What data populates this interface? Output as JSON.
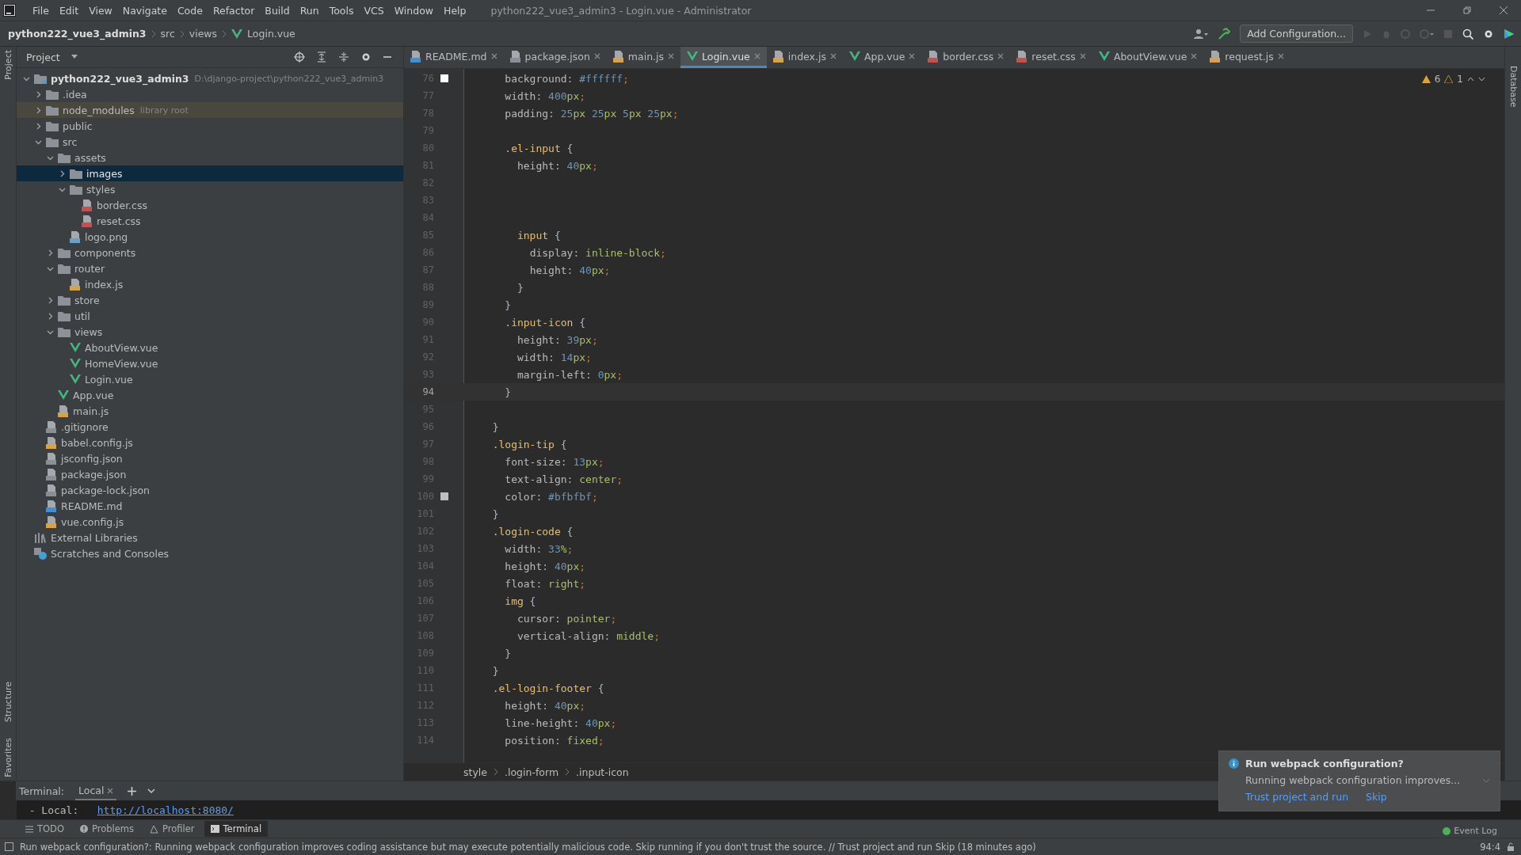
{
  "window": {
    "title": "python222_vue3_admin3 - Login.vue - Administrator",
    "menu": [
      "File",
      "Edit",
      "View",
      "Navigate",
      "Code",
      "Refactor",
      "Build",
      "Run",
      "Tools",
      "VCS",
      "Window",
      "Help"
    ]
  },
  "nav": {
    "crumbs": [
      {
        "label": "python222_vue3_admin3",
        "kind": "project"
      },
      {
        "label": "src",
        "kind": "folder"
      },
      {
        "label": "views",
        "kind": "folder"
      },
      {
        "label": "Login.vue",
        "kind": "vue"
      }
    ],
    "run_config": "Add Configuration..."
  },
  "side_strip": {
    "top": "Project",
    "bottom": [
      "Structure",
      "Favorites"
    ],
    "right": "Database"
  },
  "project": {
    "title": "Project",
    "tree": [
      {
        "name": "python222_vue3_admin3",
        "kind": "root",
        "hint": "D:\\django-project\\python222_vue3_admin3",
        "expanded": true,
        "selected": false,
        "children": [
          {
            "name": ".idea",
            "kind": "folder",
            "expanded": false,
            "selected": false
          },
          {
            "name": "node_modules",
            "kind": "folder",
            "hint": "library root",
            "library": true,
            "expanded": false,
            "selected": false
          },
          {
            "name": "public",
            "kind": "folder",
            "expanded": false,
            "selected": false
          },
          {
            "name": "src",
            "kind": "folder",
            "expanded": true,
            "selected": false,
            "children": [
              {
                "name": "assets",
                "kind": "folder",
                "expanded": true,
                "selected": false,
                "children": [
                  {
                    "name": "images",
                    "kind": "folder",
                    "expanded": false,
                    "selected": true
                  },
                  {
                    "name": "styles",
                    "kind": "folder",
                    "expanded": true,
                    "selected": false,
                    "children": [
                      {
                        "name": "border.css",
                        "kind": "css",
                        "selected": false
                      },
                      {
                        "name": "reset.css",
                        "kind": "css",
                        "selected": false
                      }
                    ]
                  },
                  {
                    "name": "logo.png",
                    "kind": "png",
                    "selected": false
                  }
                ]
              },
              {
                "name": "components",
                "kind": "folder",
                "expanded": false,
                "selected": false
              },
              {
                "name": "router",
                "kind": "folder",
                "expanded": true,
                "selected": false,
                "children": [
                  {
                    "name": "index.js",
                    "kind": "js",
                    "selected": false
                  }
                ]
              },
              {
                "name": "store",
                "kind": "folder",
                "expanded": false,
                "selected": false
              },
              {
                "name": "util",
                "kind": "folder",
                "expanded": false,
                "selected": false
              },
              {
                "name": "views",
                "kind": "folder",
                "expanded": true,
                "selected": false,
                "children": [
                  {
                    "name": "AboutView.vue",
                    "kind": "vue",
                    "selected": false
                  },
                  {
                    "name": "HomeView.vue",
                    "kind": "vue",
                    "selected": false
                  },
                  {
                    "name": "Login.vue",
                    "kind": "vue",
                    "selected": false
                  }
                ]
              },
              {
                "name": "App.vue",
                "kind": "vue",
                "selected": false
              },
              {
                "name": "main.js",
                "kind": "js",
                "selected": false
              }
            ]
          },
          {
            "name": ".gitignore",
            "kind": "file",
            "selected": false
          },
          {
            "name": "babel.config.js",
            "kind": "js",
            "selected": false
          },
          {
            "name": "jsconfig.json",
            "kind": "file",
            "selected": false
          },
          {
            "name": "package.json",
            "kind": "file",
            "selected": false
          },
          {
            "name": "package-lock.json",
            "kind": "file",
            "selected": false
          },
          {
            "name": "README.md",
            "kind": "md",
            "selected": false
          },
          {
            "name": "vue.config.js",
            "kind": "js",
            "selected": false
          }
        ]
      },
      {
        "name": "External Libraries",
        "kind": "libs",
        "selected": false
      },
      {
        "name": "Scratches and Consoles",
        "kind": "scratch",
        "selected": false
      }
    ]
  },
  "tabs": [
    {
      "label": "README.md",
      "kind": "md",
      "selected": false
    },
    {
      "label": "package.json",
      "kind": "file",
      "selected": false
    },
    {
      "label": "main.js",
      "kind": "js",
      "selected": false
    },
    {
      "label": "Login.vue",
      "kind": "vue",
      "selected": true
    },
    {
      "label": "index.js",
      "kind": "js",
      "selected": false
    },
    {
      "label": "App.vue",
      "kind": "vue",
      "selected": false
    },
    {
      "label": "border.css",
      "kind": "css",
      "selected": false
    },
    {
      "label": "reset.css",
      "kind": "css",
      "selected": false
    },
    {
      "label": "AboutView.vue",
      "kind": "vue",
      "selected": false
    },
    {
      "label": "request.js",
      "kind": "js",
      "selected": false
    }
  ],
  "inspections": {
    "warnings": "6",
    "weak_warnings": "1"
  },
  "editor": {
    "lines": [
      {
        "n": "76",
        "text": "    background: #ffffff;",
        "color": "#ffffff",
        "selected": false
      },
      {
        "n": "77",
        "text": "    width: 400px;",
        "selected": false
      },
      {
        "n": "78",
        "text": "    padding: 25px 25px 5px 25px;",
        "selected": false
      },
      {
        "n": "79",
        "selected": false
      },
      {
        "n": "80",
        "text": "    .el-input {",
        "selected": false
      },
      {
        "n": "81",
        "text": "      height: 40px;",
        "selected": false
      },
      {
        "n": "82",
        "selected": false
      },
      {
        "n": "83",
        "selected": false
      },
      {
        "n": "84",
        "selected": false
      },
      {
        "n": "85",
        "text": "      input {",
        "selected": false
      },
      {
        "n": "86",
        "text": "        display: inline-block;",
        "selected": false
      },
      {
        "n": "87",
        "text": "        height: 40px;",
        "selected": false
      },
      {
        "n": "88",
        "text": "      }",
        "selected": false
      },
      {
        "n": "89",
        "text": "    }",
        "selected": false
      },
      {
        "n": "90",
        "text": "    .input-icon {",
        "selected": false
      },
      {
        "n": "91",
        "text": "      height: 39px;",
        "selected": false
      },
      {
        "n": "92",
        "text": "      width: 14px;",
        "selected": false
      },
      {
        "n": "93",
        "text": "      margin-left: 0px;",
        "selected": false
      },
      {
        "n": "94",
        "text": "    }",
        "selected": true
      },
      {
        "n": "95",
        "selected": false
      },
      {
        "n": "96",
        "text": "  }",
        "selected": false
      },
      {
        "n": "97",
        "text": "  .login-tip {",
        "selected": false
      },
      {
        "n": "98",
        "text": "    font-size: 13px;",
        "selected": false
      },
      {
        "n": "99",
        "text": "    text-align: center;",
        "selected": false
      },
      {
        "n": "100",
        "text": "    color: #bfbfbf;",
        "color": "#bfbfbf",
        "selected": false
      },
      {
        "n": "101",
        "text": "  }",
        "selected": false
      },
      {
        "n": "102",
        "text": "  .login-code {",
        "selected": false
      },
      {
        "n": "103",
        "text": "    width: 33%;",
        "selected": false
      },
      {
        "n": "104",
        "text": "    height: 40px;",
        "selected": false
      },
      {
        "n": "105",
        "text": "    float: right;",
        "selected": false
      },
      {
        "n": "106",
        "text": "    img {",
        "selected": false
      },
      {
        "n": "107",
        "text": "      cursor: pointer;",
        "selected": false
      },
      {
        "n": "108",
        "text": "      vertical-align: middle;",
        "selected": false
      },
      {
        "n": "109",
        "text": "    }",
        "selected": false
      },
      {
        "n": "110",
        "text": "  }",
        "selected": false
      },
      {
        "n": "111",
        "text": "  .el-login-footer {",
        "selected": false
      },
      {
        "n": "112",
        "text": "    height: 40px;",
        "selected": false
      },
      {
        "n": "113",
        "text": "    line-height: 40px;",
        "selected": false
      },
      {
        "n": "114",
        "text": "    position: fixed;",
        "selected": false
      }
    ],
    "breadcrumb": [
      "style",
      ".login-form",
      ".input-icon"
    ]
  },
  "terminal": {
    "label": "Terminal:",
    "tabs": [
      {
        "label": "Local",
        "selected": true
      }
    ],
    "output_prefix": "  - Local:   ",
    "output_link": "http://localhost:8080/"
  },
  "tool_tabs": [
    {
      "label": "TODO",
      "kind": "todo",
      "selected": false
    },
    {
      "label": "Problems",
      "kind": "problems",
      "selected": false
    },
    {
      "label": "Profiler",
      "kind": "profiler",
      "selected": false
    },
    {
      "label": "Terminal",
      "kind": "terminal",
      "selected": true
    }
  ],
  "notification": {
    "title": "Run webpack configuration?",
    "body": "Running webpack configuration improves...",
    "actions": [
      "Trust project and run",
      "Skip"
    ]
  },
  "status_bar": {
    "message": "Run webpack configuration?: Running webpack configuration improves coding assistance but may execute potentially malicious code. Skip running if you don't trust the source. // Trust project and run   Skip (18 minutes ago)",
    "event_log": "Event Log",
    "position": "94:4"
  }
}
